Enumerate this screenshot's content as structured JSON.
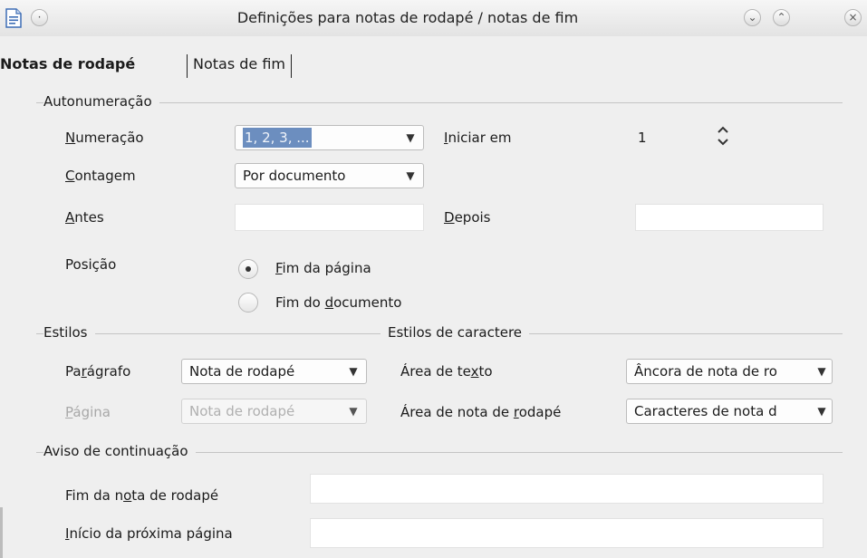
{
  "window": {
    "title": "Definições para notas de rodapé / notas de fim"
  },
  "tabs": [
    {
      "label": "Notas de rodapé",
      "active": true
    },
    {
      "label": "Notas de fim",
      "active": false
    }
  ],
  "autonumbering": {
    "section_label": "Autonumeração",
    "numbering": {
      "label_u": "N",
      "label_rest": "umeração",
      "value": "1, 2, 3, ..."
    },
    "start_at": {
      "label_u": "I",
      "label_rest": "niciar em",
      "value": "1"
    },
    "counting": {
      "label_u": "C",
      "label_rest": "ontagem",
      "value": "Por documento"
    },
    "before": {
      "label_u": "A",
      "label_rest": "ntes",
      "value": ""
    },
    "after": {
      "label_u": "D",
      "label_rest": "epois",
      "value": ""
    },
    "position": {
      "label": "Posição",
      "options": [
        {
          "pre": "",
          "u": "F",
          "post": "im da página",
          "selected": true
        },
        {
          "pre": "Fim do ",
          "u": "d",
          "post": "ocumento",
          "selected": false
        }
      ]
    }
  },
  "styles": {
    "section_label": "Estilos",
    "paragraph": {
      "pre": "Pa",
      "u": "r",
      "post": "ágrafo",
      "value": "Nota de rodapé"
    },
    "page": {
      "pre": "",
      "u": "P",
      "post": "ágina",
      "value": "Nota de rodapé",
      "disabled": true
    }
  },
  "char_styles": {
    "section_label": "Estilos de caractere",
    "text_area": {
      "pre": "Área de te",
      "u": "x",
      "post": "to",
      "value": "Âncora de nota de ro"
    },
    "footnote_area": {
      "pre": "Área de nota de ",
      "u": "r",
      "post": "odapé",
      "value": "Caracteres de nota d"
    }
  },
  "continuation": {
    "section_label": "Aviso de continuação",
    "end_of_footnote": {
      "pre": "Fim da n",
      "u": "o",
      "post": "ta de rodapé",
      "value": ""
    },
    "start_of_next_page": {
      "pre": "",
      "u": "I",
      "post": "nício da próxima página",
      "value": ""
    }
  },
  "icons": [
    "document-icon",
    "window-menu-icon",
    "minimize-icon",
    "maximize-icon",
    "close-icon",
    "chevron-down-icon",
    "spin-updown-icon"
  ]
}
